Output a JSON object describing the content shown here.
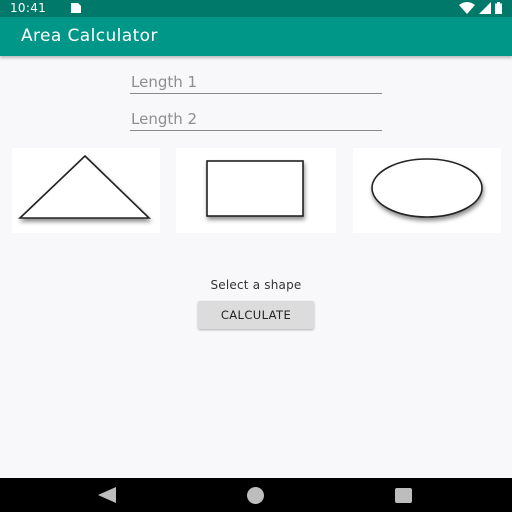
{
  "status_bar": {
    "time": "10:41",
    "icons": [
      "sd-card-icon",
      "wifi-icon",
      "signal-icon",
      "battery-icon"
    ]
  },
  "app_bar": {
    "title": "Area Calculator",
    "color": "#009688",
    "status_color": "#00796b"
  },
  "form": {
    "length1": {
      "value": "",
      "placeholder": "Length 1"
    },
    "length2": {
      "value": "",
      "placeholder": "Length 2"
    }
  },
  "shapes": [
    {
      "name": "triangle",
      "icon": "triangle-icon"
    },
    {
      "name": "square",
      "icon": "square-icon"
    },
    {
      "name": "circle",
      "icon": "circle-icon"
    }
  ],
  "prompt": "Select a shape",
  "calculate_label": "CALCULATE",
  "nav_bar": {
    "icons": [
      "back-icon",
      "home-icon",
      "recents-icon"
    ]
  }
}
